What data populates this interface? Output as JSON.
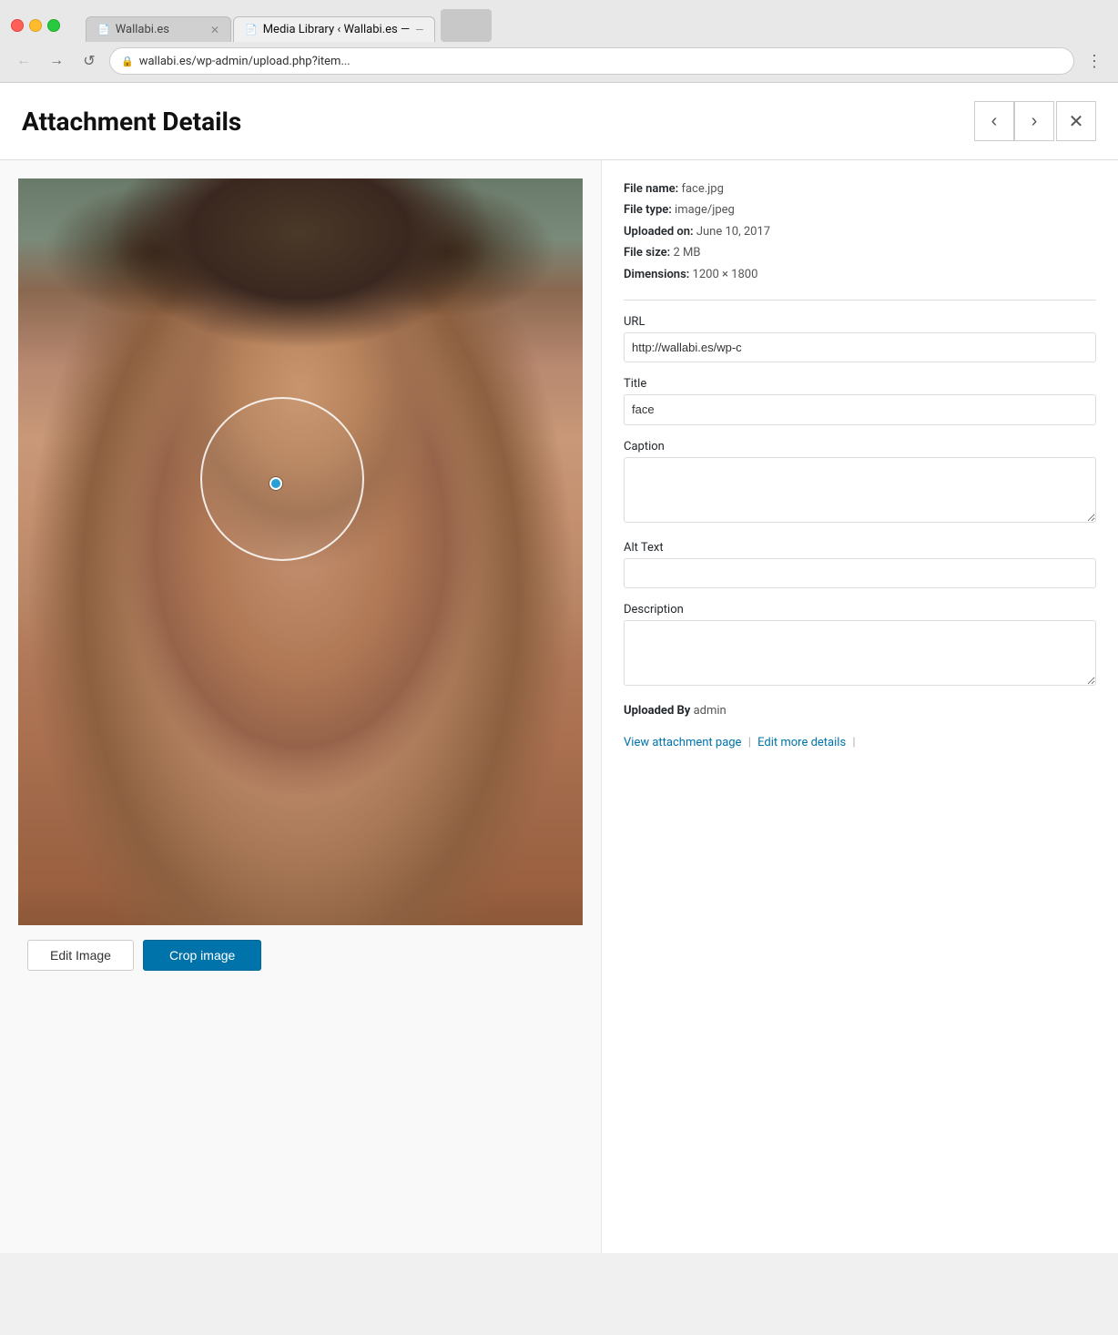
{
  "browser": {
    "tabs": [
      {
        "id": "tab1",
        "label": "Wallabi.es",
        "active": false,
        "icon": "📄"
      },
      {
        "id": "tab2",
        "label": "Media Library ‹ Wallabi.es —",
        "active": true,
        "icon": "📄"
      }
    ],
    "address": "wallabi.es/wp-admin/upload.php?item...",
    "nav": {
      "back": "←",
      "forward": "→",
      "refresh": "↺",
      "menu": "⋮"
    }
  },
  "panel": {
    "title": "Attachment Details",
    "nav_prev": "‹",
    "nav_next": "›",
    "close": "✕"
  },
  "file_meta": {
    "name_label": "File name:",
    "name_value": "face.jpg",
    "type_label": "File type:",
    "type_value": "image/jpeg",
    "uploaded_label": "Uploaded on:",
    "uploaded_value": "June 10, 2017",
    "size_label": "File size:",
    "size_value": "2 MB",
    "dimensions_label": "Dimensions:",
    "dimensions_value": "1200 × 1800"
  },
  "fields": {
    "url_label": "URL",
    "url_value": "http://wallabi.es/wp-c",
    "title_label": "Title",
    "title_value": "face",
    "caption_label": "Caption",
    "caption_value": "",
    "alt_label": "Alt Text",
    "alt_value": "",
    "description_label": "Description",
    "description_value": ""
  },
  "uploaded_by": {
    "label": "Uploaded By",
    "value": "admin"
  },
  "actions": {
    "edit_image": "Edit Image",
    "crop_image": "Crop image",
    "view_attachment": "View attachment page",
    "edit_more": "Edit more details",
    "separator": "|"
  }
}
